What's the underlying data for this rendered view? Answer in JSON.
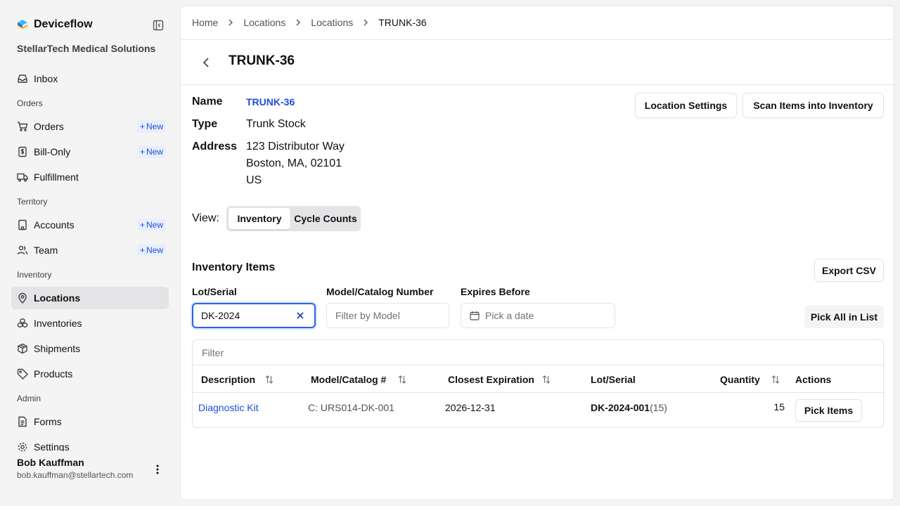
{
  "app": {
    "name": "Deviceflow",
    "org": "StellarTech Medical Solutions"
  },
  "sidebar": {
    "sections": {
      "orders": "Orders",
      "territory": "Territory",
      "inventory": "Inventory",
      "admin": "Admin"
    },
    "items": {
      "inbox": "Inbox",
      "orders": "Orders",
      "bill_only": "Bill-Only",
      "fulfillment": "Fulfillment",
      "accounts": "Accounts",
      "team": "Team",
      "locations": "Locations",
      "inventories": "Inventories",
      "shipments": "Shipments",
      "products": "Products",
      "forms": "Forms",
      "settings": "Settings"
    },
    "new_label": "New",
    "active_item": "Locations"
  },
  "user": {
    "name": "Bob Kauffman",
    "email": "bob.kauffman@stellartech.com"
  },
  "breadcrumb": {
    "home": "Home",
    "locations_1": "Locations",
    "locations_2": "Locations",
    "current": "TRUNK-36"
  },
  "page": {
    "title": "TRUNK-36"
  },
  "details": {
    "name_label": "Name",
    "name_value": "TRUNK-36",
    "type_label": "Type",
    "type_value": "Trunk Stock",
    "address_label": "Address",
    "address_line1": "123 Distributor Way",
    "address_line2": "Boston, MA, 02101",
    "address_line3": "US"
  },
  "actions": {
    "location_settings": "Location Settings",
    "scan_items": "Scan Items into Inventory"
  },
  "view": {
    "label": "View:",
    "options": [
      "Inventory",
      "Cycle Counts"
    ],
    "selected": "Inventory"
  },
  "inventory": {
    "title": "Inventory Items",
    "export_csv": "Export CSV",
    "lot_label": "Lot/Serial",
    "lot_value": "DK-2024",
    "model_label": "Model/Catalog Number",
    "model_placeholder": "Filter by Model",
    "expires_label": "Expires Before",
    "expires_placeholder": "Pick a date",
    "pick_all": "Pick All in List",
    "filter_placeholder": "Filter",
    "columns": {
      "description": "Description",
      "model": "Model/Catalog #",
      "expiration": "Closest Expiration",
      "lot": "Lot/Serial",
      "quantity": "Quantity",
      "actions": "Actions"
    },
    "rows": [
      {
        "description": "Diagnostic Kit",
        "model": "C: URS014-DK-001",
        "expiration": "2026-12-31",
        "lot": "DK-2024-001",
        "lot_count": "(15)",
        "quantity": "15",
        "action": "Pick Items"
      }
    ]
  },
  "colors": {
    "accent": "#1d4ed8",
    "focus": "#2563eb",
    "badge_bg": "#e8eefc"
  }
}
